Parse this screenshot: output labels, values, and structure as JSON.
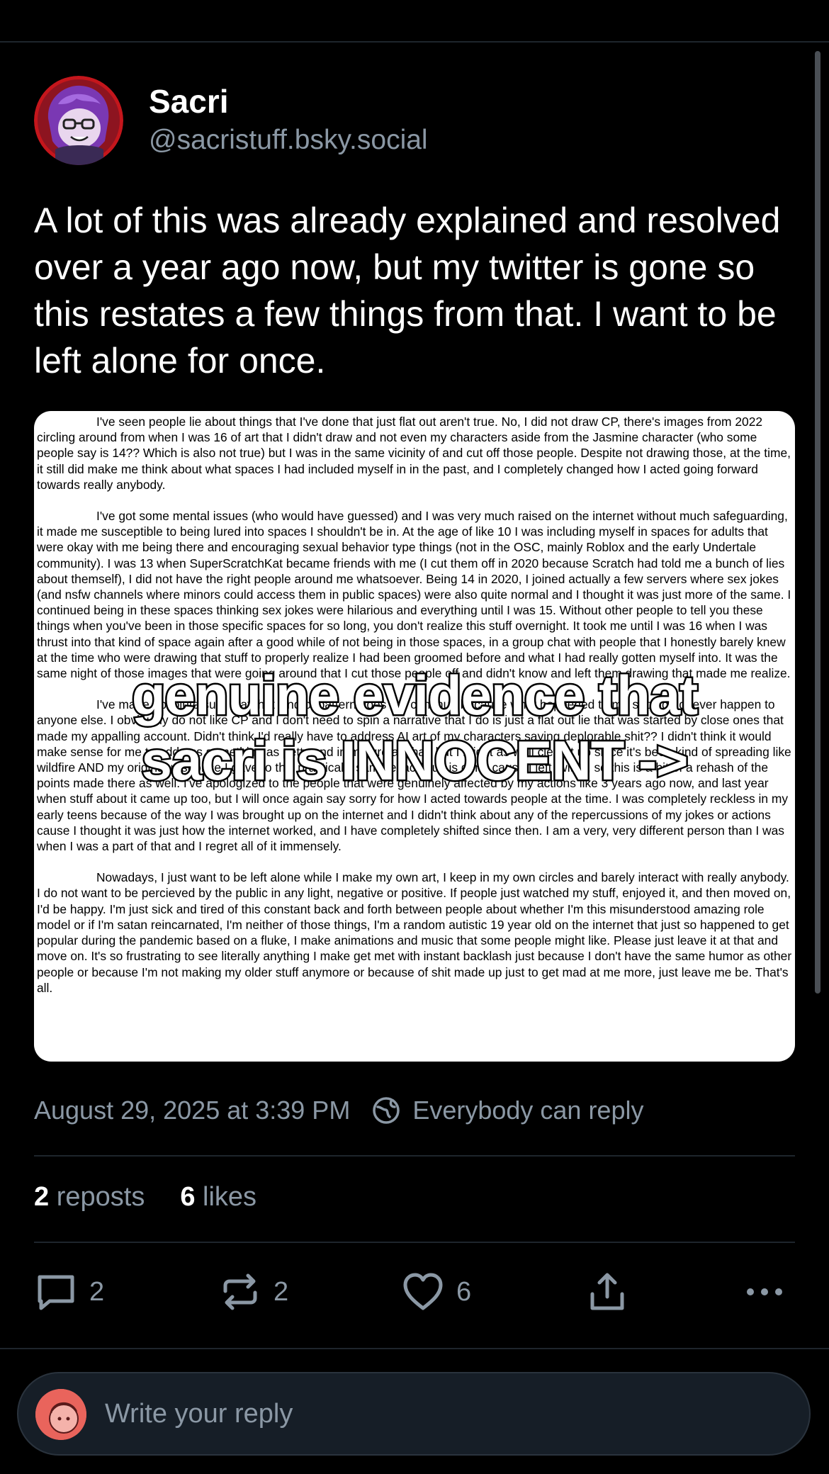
{
  "post": {
    "author_name": "Sacri",
    "author_handle": "@sacristuff.bsky.social",
    "text": "A lot of this was already explained and resolved over a year ago now, but my twitter is gone so this restates a few things from that. I want to be left alone for once.",
    "image": {
      "paragraphs": [
        "I've seen people lie about things that I've done that just flat out aren't true. No, I did not draw CP, there's images from 2022 circling around from when I was 16 of art that I didn't draw and not even my characters aside from the Jasmine character (who some people say is 14?? Which is also not true) but I was in the same vicinity of and cut off those people. Despite not drawing those, at the time, it still did make me think about what spaces I had included myself in in the past, and I completely changed how I acted going forward towards really anybody.",
        "I've got some mental issues (who would have guessed) and I was very much raised on the internet without much safeguarding, it made me susceptible to being lured into spaces I shouldn't be in. At the age of like 10 I was including myself in spaces for adults that were okay with me being there and encouraging sexual behavior type things (not in the OSC, mainly Roblox and the early Undertale community). I was 13 when SuperScratchKat became friends with me (I cut them off in 2020 because Scratch had told me a bunch of lies about themself), I did not have the right people around me whatsoever. Being 14 in 2020, I joined actually a few servers where sex jokes (and nsfw channels where minors could access them in public spaces) were also quite normal and I thought it was just more of the same. I continued being in these spaces thinking sex jokes were hilarious and everything until I was 15. Without other people to tell you these things when you've been in those specific spaces for so long, you don't realize this stuff overnight. It took me until I was 16 when I was thrust into that kind of space again after a good while of not being in those spaces, in a group chat with people that I honestly barely knew at the time who were drawing that stuff to properly realize I had been groomed before and what I had really gotten myself into. It was the same night of those images that were going around that I cut those people off and didn't know and left them drawing that made me realize.",
        "I've made absolute sure that that kind of pattern does not continue because what happened to me should not ever happen to anyone else. I obviously do not like CP and I don't need to spin a narrative that I do is just a flat out lie that was started by close ones that made my appalling account. Didn't think I'd really have to address AI art of my characters saying deplorable shit?? I didn't think it would make sense for me to address something as petty and immature as that, but I might as well clear it up since it's been kind of spreading like wildfire AND my original response I gave to this practically same exact stuff is gone cause I left twitter, so this is a bit of a rehash of the points made there as well. I've apologized to the people that were genuinely affected by my actions like 3 years ago now, and last year when stuff about it came up too, but I will once again say sorry for how I acted towards people at the time. I was completely reckless in my early teens because of the way I was brought up on the internet and I didn't think about any of the repercussions of my jokes or actions cause I thought it was just how the internet worked, and I have completely shifted since then. I am a very, very different person than I was when I was a part of that and I regret all of it immensely.",
        "Nowadays, I just want to be left alone while I make my own art, I keep in my own circles and barely interact with really anybody. I do not want to be percieved by the public in any light, negative or positive. If people just watched my stuff, enjoyed it, and then moved on, I'd be happy. I'm just sick and tired of this constant back and forth between people about whether I'm this misunderstood amazing role model or if I'm satan reincarnated, I'm neither of those things, I'm a random autistic 19 year old on the internet that just so happened to get popular during the pandemic based on a fluke, I make animations and music that some people might like. Please just leave it at that and move on. It's so frustrating to see literally anything I make get met with instant backlash just because I don't have the same humor as other people or because I'm not making my older stuff anymore or because of shit made up just to get mad at me more, just leave me be. That's all."
      ],
      "overlay_line_1": "genuine evidence that",
      "overlay_line_2": "sacri is INNOCENT ->"
    },
    "timestamp": "August 29, 2025 at 3:39 PM",
    "reply_setting": "Everybody can reply",
    "reposts_count": "2",
    "reposts_label": "reposts",
    "likes_count": "6",
    "likes_label": "likes"
  },
  "actions": {
    "reply_count": "2",
    "repost_count": "2",
    "like_count": "6"
  },
  "composer": {
    "placeholder": "Write your reply"
  },
  "colors": {
    "background": "#000000",
    "muted_text": "#8b98a5",
    "divider": "#1e252c",
    "avatar_purple": "#7b3fb0",
    "avatar_red": "#d8232a",
    "composer_bg": "#161e27"
  },
  "icons": {
    "reply": "speech-bubble-icon",
    "repost": "repost-arrows-icon",
    "like": "heart-icon",
    "share": "share-upload-icon",
    "more": "more-dots-icon",
    "reply_setting": "globe-reply-icon"
  }
}
